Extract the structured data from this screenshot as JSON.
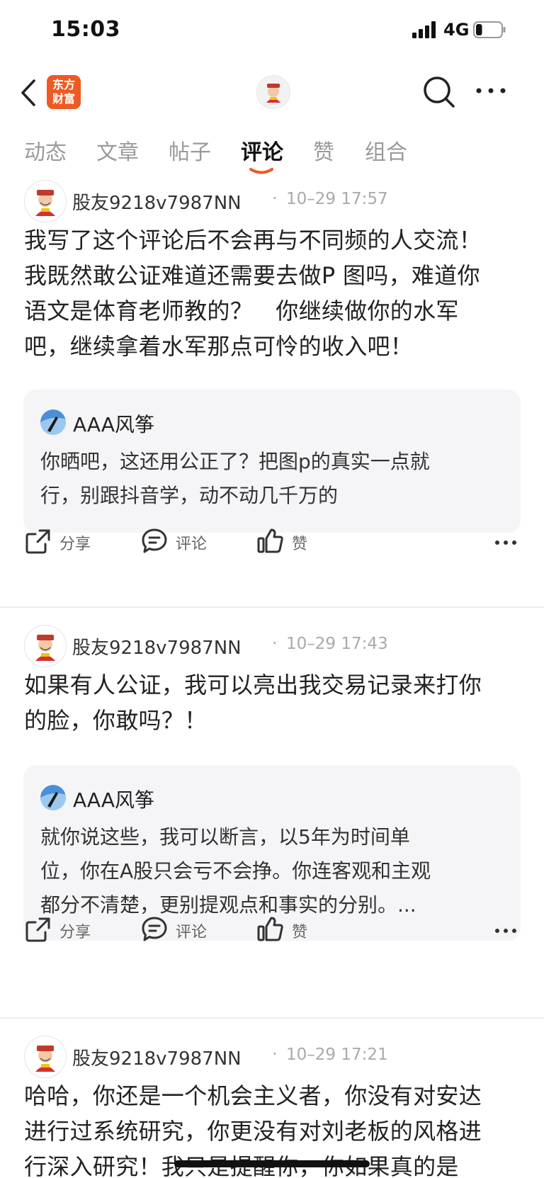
{
  "status_bar": {
    "time": "15:03",
    "network": "4G",
    "battery_level": 0.25
  },
  "nav": {
    "logo_line1": "东方",
    "logo_line2": "财富"
  },
  "tabs": [
    "动态",
    "文章",
    "帖子",
    "评论",
    "赞",
    "组合"
  ],
  "active_tab": "评论",
  "colors": {
    "accent": "#ee5a24",
    "quote_bg": "#f5f5f7",
    "muted": "#9a9a9a"
  },
  "posts": [
    {
      "user": "股友9218v7987NN",
      "dot": "·",
      "time": "10–29 17:57",
      "body": [
        "我写了这个评论后不会再与不同频的人交流！",
        "我既然敢公证难道还需要去做P 图吗，难道你",
        "语文是体育老师教的？　你继续做你的水军",
        "吧，继续拿着水军那点可怜的收入吧！"
      ],
      "quote": {
        "user": "AAA风筝",
        "lines": [
          "你晒吧，这还用公正了？把图p的真实一点就",
          "行，别跟抖音学，动不动几千万的"
        ]
      },
      "actions": {
        "share": "分享",
        "comment": "评论",
        "like": "赞"
      }
    },
    {
      "user": "股友9218v7987NN",
      "dot": "·",
      "time": "10–29 17:43",
      "body": [
        "如果有人公证，我可以亮出我交易记录来打你",
        "的脸，你敢吗？！"
      ],
      "quote": {
        "user": "AAA风筝",
        "lines": [
          "就你说这些，我可以断言，以5年为时间单",
          "位，你在A股只会亏不会挣。你连客观和主观",
          "都分不清楚，更别提观点和事实的分别。..."
        ]
      },
      "actions": {
        "share": "分享",
        "comment": "评论",
        "like": "赞"
      }
    },
    {
      "user": "股友9218v7987NN",
      "dot": "·",
      "time": "10–29 17:21",
      "body": [
        "哈哈，你还是一个机会主义者，你没有对安达",
        "进行过系统研究，你更没有对刘老板的风格进",
        "行深入研究！我只是提醒你，你如果真的是"
      ]
    }
  ]
}
